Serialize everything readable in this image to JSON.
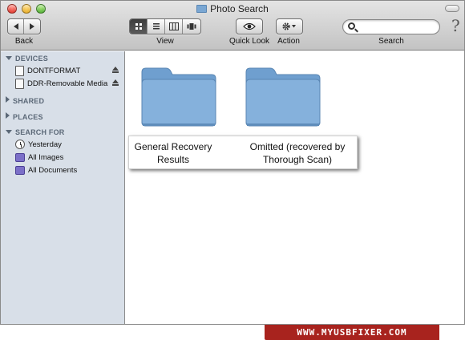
{
  "window": {
    "title": "Photo Search"
  },
  "toolbar": {
    "back_label": "Back",
    "view_label": "View",
    "quicklook_label": "Quick Look",
    "action_label": "Action",
    "search_label": "Search",
    "search_value": "",
    "help_glyph": "?"
  },
  "icons": {
    "back": "left-arrow-icon",
    "forward": "right-arrow-icon",
    "view_icons": "icon-view-icon",
    "view_list": "list-view-icon",
    "view_columns": "column-view-icon",
    "view_coverflow": "coverflow-view-icon",
    "quicklook": "eye-icon",
    "action": "gear-icon",
    "search": "magnifier-icon"
  },
  "sidebar": {
    "sections": [
      {
        "title": "DEVICES",
        "expanded": true,
        "items": [
          {
            "label": "DONTFORMAT",
            "icon": "disk-icon",
            "eject": true
          },
          {
            "label": "DDR-Removable Media",
            "icon": "disk-icon",
            "eject": true
          }
        ]
      },
      {
        "title": "SHARED",
        "expanded": false,
        "items": []
      },
      {
        "title": "PLACES",
        "expanded": false,
        "items": []
      },
      {
        "title": "SEARCH FOR",
        "expanded": true,
        "items": [
          {
            "label": "Yesterday",
            "icon": "clock-icon"
          },
          {
            "label": "All Images",
            "icon": "smart-folder-icon"
          },
          {
            "label": "All Documents",
            "icon": "smart-folder-icon"
          }
        ]
      }
    ]
  },
  "content": {
    "folders": [
      {
        "line1": "General Recovery",
        "line2": "Results"
      },
      {
        "line1": "Omitted (recovered by",
        "line2": "Thorough Scan)"
      }
    ]
  },
  "colors": {
    "folder": "#7aa7d3",
    "sidebar": "#d8dfe8",
    "banner": "#a8231e"
  },
  "watermark": {
    "text": "WWW.MYUSBFIXER.COM"
  }
}
